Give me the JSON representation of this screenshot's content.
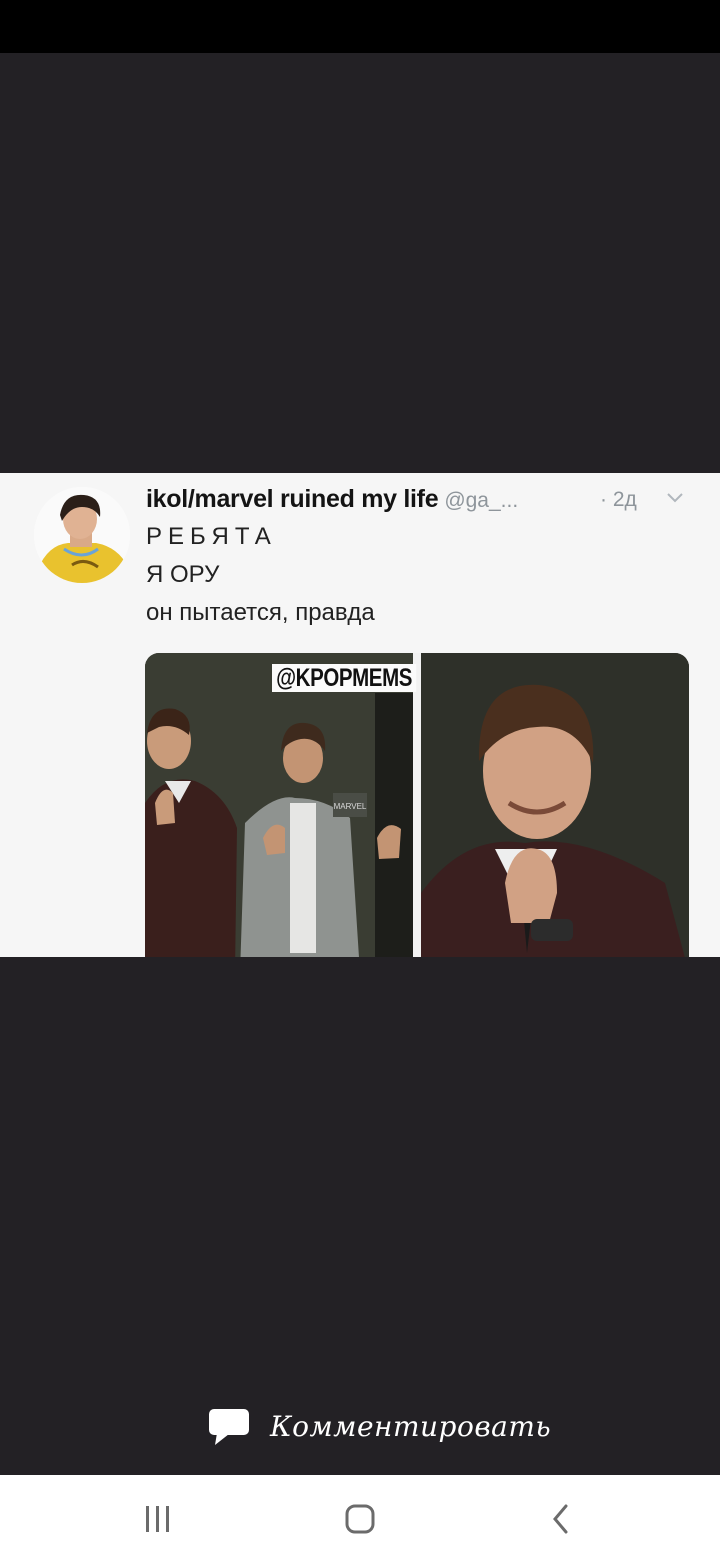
{
  "tweet": {
    "display_name": "ikol/marvel ruined my life",
    "handle": "@ga_...",
    "time": "· 2д",
    "lines": [
      "РЕБЯТА",
      "Я ОРУ",
      "он пытается, правда"
    ],
    "watermark": "@KPOPMEMS",
    "sign_text": "MARVEL"
  },
  "actions": {
    "comment_label": "Комментировать",
    "comment_icon": "speech-bubble-icon"
  },
  "nav": {
    "recents_icon": "recents-icon",
    "home_icon": "home-icon",
    "back_icon": "back-icon"
  },
  "colors": {
    "viewer_bg": "#232125",
    "status_bar": "#000000",
    "nav_bg": "#ffffff",
    "nav_icon": "#6b6b6b"
  }
}
